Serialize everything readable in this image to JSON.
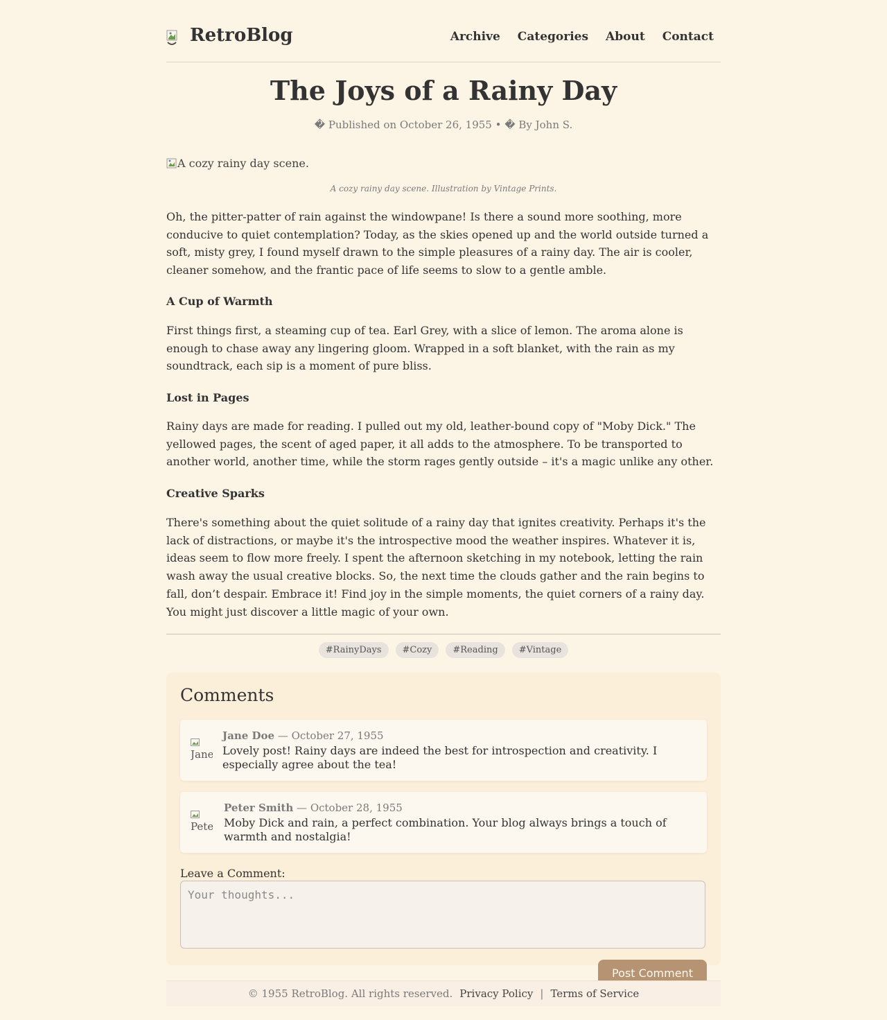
{
  "header": {
    "brand": "RetroBlog",
    "nav": [
      "Archive",
      "Categories",
      "About",
      "Contact"
    ]
  },
  "post": {
    "title": "The Joys of a Rainy Day",
    "meta": "� Published on October 26, 1955 • � By John S.",
    "image_alt": "A cozy rainy day scene.",
    "caption": "A cozy rainy day scene. Illustration by Vintage Prints.",
    "intro": "Oh, the pitter-patter of rain against the windowpane! Is there a sound more soothing, more conducive to quiet contemplation? Today, as the skies opened up and the world outside turned a soft, misty grey, I found myself drawn to the simple pleasures of a rainy day. The air is cooler, cleaner somehow, and the frantic pace of life seems to slow to a gentle amble.",
    "sections": [
      {
        "heading": "A Cup of Warmth",
        "body": "First things first, a steaming cup of tea. Earl Grey, with a slice of lemon. The aroma alone is enough to chase away any lingering gloom. Wrapped in a soft blanket, with the rain as my soundtrack, each sip is a moment of pure bliss."
      },
      {
        "heading": "Lost in Pages",
        "body": "Rainy days are made for reading. I pulled out my old, leather-bound copy of \"Moby Dick.\" The yellowed pages, the scent of aged paper, it all adds to the atmosphere. To be transported to another world, another time, while the storm rages gently outside – it's a magic unlike any other."
      },
      {
        "heading": "Creative Sparks",
        "body": "There's something about the quiet solitude of a rainy day that ignites creativity. Perhaps it's the lack of distractions, or maybe it's the introspective mood the weather inspires. Whatever it is, ideas seem to flow more freely. I spent the afternoon sketching in my notebook, letting the rain wash away the usual creative blocks. So, the next time the clouds gather and the rain begins to fall, don’t despair. Embrace it! Find joy in the simple moments, the quiet corners of a rainy day. You might just discover a little magic of your own."
      }
    ],
    "tags": [
      "#RainyDays",
      "#Cozy",
      "#Reading",
      "#Vintage"
    ]
  },
  "comments": {
    "heading": "Comments",
    "items": [
      {
        "author": "Jane Doe",
        "date": "— October 27, 1955",
        "avatar_alt": "Jane",
        "text": "Lovely post! Rainy days are indeed the best for introspection and creativity. I especially agree about the tea!"
      },
      {
        "author": "Peter Smith",
        "date": "— October 28, 1955",
        "avatar_alt": "Peter",
        "text": "Moby Dick and rain, a perfect combination. Your blog always brings a touch of warmth and nostalgia!"
      }
    ],
    "leave_label": "Leave a Comment:",
    "placeholder": "Your thoughts...",
    "submit_label": "Post Comment"
  },
  "footer": {
    "copyright": "© 1955 RetroBlog. All rights reserved.",
    "privacy": "Privacy Policy",
    "separator": "|",
    "terms": "Terms of Service"
  },
  "colors": {
    "background": "#fcf5e6",
    "accent": "#b69372",
    "text": "#333333"
  }
}
